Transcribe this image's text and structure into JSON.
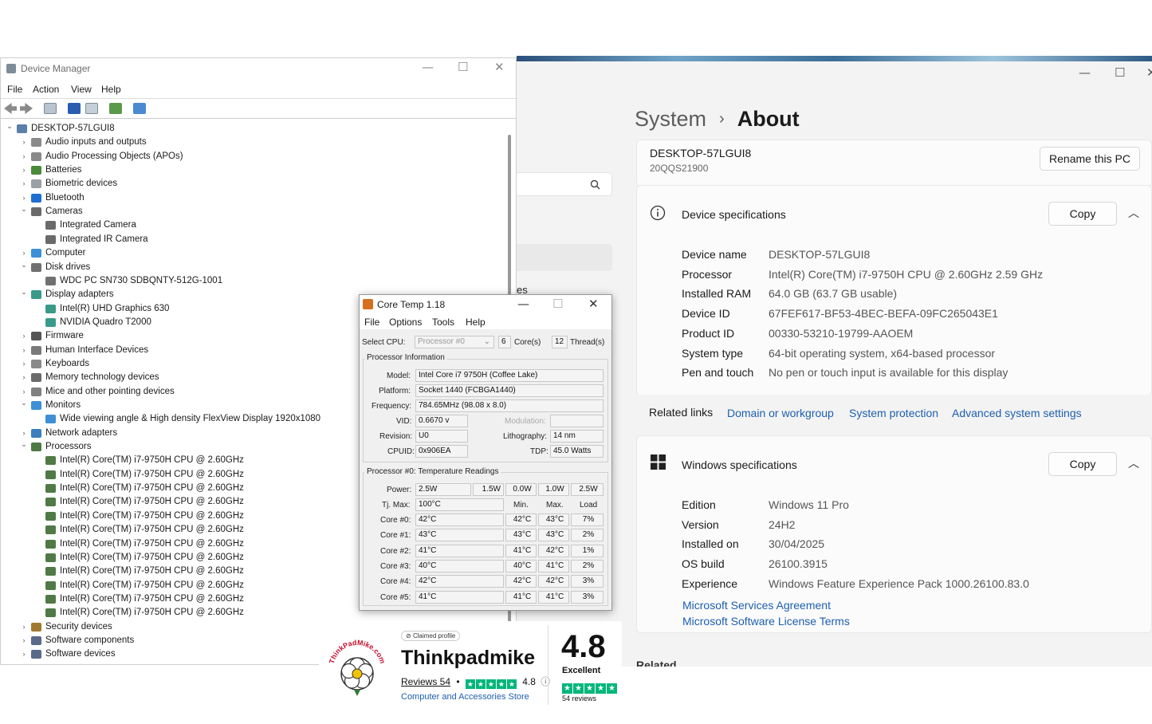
{
  "settings": {
    "crumb_system": "System",
    "crumb_sep": "›",
    "crumb_about": "About",
    "left_fragment": "es",
    "pc_name": "DESKTOP-57LGUI8",
    "pc_model": "20QQS21900",
    "rename_button": "Rename this PC",
    "device_spec_title": "Device specifications",
    "copy_label": "Copy",
    "device_specs": [
      {
        "k": "Device name",
        "v": "DESKTOP-57LGUI8"
      },
      {
        "k": "Processor",
        "v": "Intel(R) Core(TM) i7-9750H CPU @ 2.60GHz   2.59 GHz"
      },
      {
        "k": "Installed RAM",
        "v": "64.0 GB (63.7 GB usable)"
      },
      {
        "k": "Device ID",
        "v": "67FEF617-BF53-4BEC-BEFA-09FC265043E1"
      },
      {
        "k": "Product ID",
        "v": "00330-53210-19799-AAOEM"
      },
      {
        "k": "System type",
        "v": "64-bit operating system, x64-based processor"
      },
      {
        "k": "Pen and touch",
        "v": "No pen or touch input is available for this display"
      }
    ],
    "related_links_label": "Related links",
    "related_links": [
      "Domain or workgroup",
      "System protection",
      "Advanced system settings"
    ],
    "windows_spec_title": "Windows specifications",
    "windows_specs": [
      {
        "k": "Edition",
        "v": "Windows 11 Pro"
      },
      {
        "k": "Version",
        "v": "24H2"
      },
      {
        "k": "Installed on",
        "v": "30/04/2025"
      },
      {
        "k": "OS build",
        "v": "26100.3915"
      },
      {
        "k": "Experience",
        "v": "Windows Feature Experience Pack 1000.26100.83.0"
      }
    ],
    "windows_links": [
      "Microsoft Services Agreement",
      "Microsoft Software License Terms"
    ],
    "bottom_fragment": "Related"
  },
  "device_manager": {
    "title": "Device Manager",
    "menu": [
      "File",
      "Action",
      "View",
      "Help"
    ],
    "tree": [
      {
        "label": "DESKTOP-57LGUI8",
        "level": 0,
        "exp": "v",
        "icon": "computer"
      },
      {
        "label": "Audio inputs and outputs",
        "level": 1,
        "exp": ">",
        "icon": "audio"
      },
      {
        "label": "Audio Processing Objects (APOs)",
        "level": 1,
        "exp": ">",
        "icon": "audio"
      },
      {
        "label": "Batteries",
        "level": 1,
        "exp": ">",
        "icon": "battery"
      },
      {
        "label": "Biometric devices",
        "level": 1,
        "exp": ">",
        "icon": "biometric"
      },
      {
        "label": "Bluetooth",
        "level": 1,
        "exp": ">",
        "icon": "bluetooth"
      },
      {
        "label": "Cameras",
        "level": 1,
        "exp": "v",
        "icon": "camera"
      },
      {
        "label": "Integrated Camera",
        "level": 2,
        "exp": "",
        "icon": "camera"
      },
      {
        "label": "Integrated IR Camera",
        "level": 2,
        "exp": "",
        "icon": "camera"
      },
      {
        "label": "Computer",
        "level": 1,
        "exp": ">",
        "icon": "monitor"
      },
      {
        "label": "Disk drives",
        "level": 1,
        "exp": "v",
        "icon": "disk"
      },
      {
        "label": "WDC PC SN730 SDBQNTY-512G-1001",
        "level": 2,
        "exp": "",
        "icon": "disk"
      },
      {
        "label": "Display adapters",
        "level": 1,
        "exp": "v",
        "icon": "display"
      },
      {
        "label": "Intel(R) UHD Graphics 630",
        "level": 2,
        "exp": "",
        "icon": "display"
      },
      {
        "label": "NVIDIA Quadro T2000",
        "level": 2,
        "exp": "",
        "icon": "display"
      },
      {
        "label": "Firmware",
        "level": 1,
        "exp": ">",
        "icon": "firmware"
      },
      {
        "label": "Human Interface Devices",
        "level": 1,
        "exp": ">",
        "icon": "hid"
      },
      {
        "label": "Keyboards",
        "level": 1,
        "exp": ">",
        "icon": "keyboard"
      },
      {
        "label": "Memory technology devices",
        "level": 1,
        "exp": ">",
        "icon": "memory"
      },
      {
        "label": "Mice and other pointing devices",
        "level": 1,
        "exp": ">",
        "icon": "mouse"
      },
      {
        "label": "Monitors",
        "level": 1,
        "exp": "v",
        "icon": "monitor"
      },
      {
        "label": "Wide viewing angle & High density FlexView Display 1920x1080",
        "level": 2,
        "exp": "",
        "icon": "monitor"
      },
      {
        "label": "Network adapters",
        "level": 1,
        "exp": ">",
        "icon": "network"
      },
      {
        "label": "Processors",
        "level": 1,
        "exp": "v",
        "icon": "cpu"
      },
      {
        "label": "Intel(R) Core(TM) i7-9750H CPU @ 2.60GHz",
        "level": 2,
        "exp": "",
        "icon": "cpu"
      },
      {
        "label": "Intel(R) Core(TM) i7-9750H CPU @ 2.60GHz",
        "level": 2,
        "exp": "",
        "icon": "cpu"
      },
      {
        "label": "Intel(R) Core(TM) i7-9750H CPU @ 2.60GHz",
        "level": 2,
        "exp": "",
        "icon": "cpu"
      },
      {
        "label": "Intel(R) Core(TM) i7-9750H CPU @ 2.60GHz",
        "level": 2,
        "exp": "",
        "icon": "cpu"
      },
      {
        "label": "Intel(R) Core(TM) i7-9750H CPU @ 2.60GHz",
        "level": 2,
        "exp": "",
        "icon": "cpu"
      },
      {
        "label": "Intel(R) Core(TM) i7-9750H CPU @ 2.60GHz",
        "level": 2,
        "exp": "",
        "icon": "cpu"
      },
      {
        "label": "Intel(R) Core(TM) i7-9750H CPU @ 2.60GHz",
        "level": 2,
        "exp": "",
        "icon": "cpu"
      },
      {
        "label": "Intel(R) Core(TM) i7-9750H CPU @ 2.60GHz",
        "level": 2,
        "exp": "",
        "icon": "cpu"
      },
      {
        "label": "Intel(R) Core(TM) i7-9750H CPU @ 2.60GHz",
        "level": 2,
        "exp": "",
        "icon": "cpu"
      },
      {
        "label": "Intel(R) Core(TM) i7-9750H CPU @ 2.60GHz",
        "level": 2,
        "exp": "",
        "icon": "cpu"
      },
      {
        "label": "Intel(R) Core(TM) i7-9750H CPU @ 2.60GHz",
        "level": 2,
        "exp": "",
        "icon": "cpu"
      },
      {
        "label": "Intel(R) Core(TM) i7-9750H CPU @ 2.60GHz",
        "level": 2,
        "exp": "",
        "icon": "cpu"
      },
      {
        "label": "Security devices",
        "level": 1,
        "exp": ">",
        "icon": "security"
      },
      {
        "label": "Software components",
        "level": 1,
        "exp": ">",
        "icon": "software"
      },
      {
        "label": "Software devices",
        "level": 1,
        "exp": ">",
        "icon": "software"
      }
    ],
    "icon_colors": {
      "computer": "#5a7fa8",
      "audio": "#8a8a8a",
      "battery": "#4a8a3a",
      "biometric": "#9aa0a6",
      "bluetooth": "#1e6fd0",
      "camera": "#6a6a6a",
      "monitor": "#3d8fd6",
      "disk": "#707070",
      "display": "#3a9a8a",
      "firmware": "#555555",
      "hid": "#7a7a7a",
      "keyboard": "#8a8a8a",
      "memory": "#6a6a6a",
      "mouse": "#808080",
      "network": "#3a7fc0",
      "cpu": "#4f7a45",
      "security": "#a07a30",
      "software": "#5a6a8a"
    }
  },
  "core_temp": {
    "title": "Core Temp 1.18",
    "menu": [
      "File",
      "Options",
      "Tools",
      "Help"
    ],
    "select_cpu_label": "Select CPU:",
    "select_cpu_value": "Processor #0",
    "cores_value": "6",
    "cores_label": "Core(s)",
    "threads_value": "12",
    "threads_label": "Thread(s)",
    "proc_info_title": "Processor Information",
    "model_label": "Model:",
    "model_value": "Intel Core i7 9750H (Coffee Lake)",
    "platform_label": "Platform:",
    "platform_value": "Socket 1440 (FCBGA1440)",
    "frequency_label": "Frequency:",
    "frequency_value": "784.65MHz (98.08 x 8.0)",
    "vid_label": "VID:",
    "vid_value": "0.6670 v",
    "modulation_label": "Modulation:",
    "revision_label": "Revision:",
    "revision_value": "U0",
    "lithography_label": "Lithography:",
    "lithography_value": "14 nm",
    "cpuid_label": "CPUID:",
    "cpuid_value": "0x906EA",
    "tdp_label": "TDP:",
    "tdp_value": "45.0 Watts",
    "temp_title": "Processor #0: Temperature Readings",
    "power_label": "Power:",
    "power_values": [
      "2.5W",
      "1.5W",
      "0.0W",
      "1.0W",
      "2.5W"
    ],
    "tjmax_label": "Tj. Max:",
    "tjmax_value": "100°C",
    "col_min": "Min.",
    "col_max": "Max.",
    "col_load": "Load",
    "cores": [
      {
        "name": "Core #0:",
        "temp": "42°C",
        "min": "42°C",
        "max": "43°C",
        "load": "7%"
      },
      {
        "name": "Core #1:",
        "temp": "43°C",
        "min": "43°C",
        "max": "43°C",
        "load": "2%"
      },
      {
        "name": "Core #2:",
        "temp": "41°C",
        "min": "41°C",
        "max": "42°C",
        "load": "1%"
      },
      {
        "name": "Core #3:",
        "temp": "40°C",
        "min": "40°C",
        "max": "41°C",
        "load": "2%"
      },
      {
        "name": "Core #4:",
        "temp": "42°C",
        "min": "42°C",
        "max": "42°C",
        "load": "3%"
      },
      {
        "name": "Core #5:",
        "temp": "41°C",
        "min": "41°C",
        "max": "41°C",
        "load": "3%"
      }
    ]
  },
  "trustpilot": {
    "claimed": "Claimed profile",
    "name": "Thinkpadmike",
    "reviews_label": "Reviews 54",
    "dot": "•",
    "rating": "4.8",
    "info": "ⓘ",
    "category": "Computer and Accessories Store",
    "score": "4.8",
    "excellent": "Excellent",
    "count": "54 reviews",
    "logo_text": "ThinkPadMike.com",
    "brand_color": "#00b67a"
  }
}
